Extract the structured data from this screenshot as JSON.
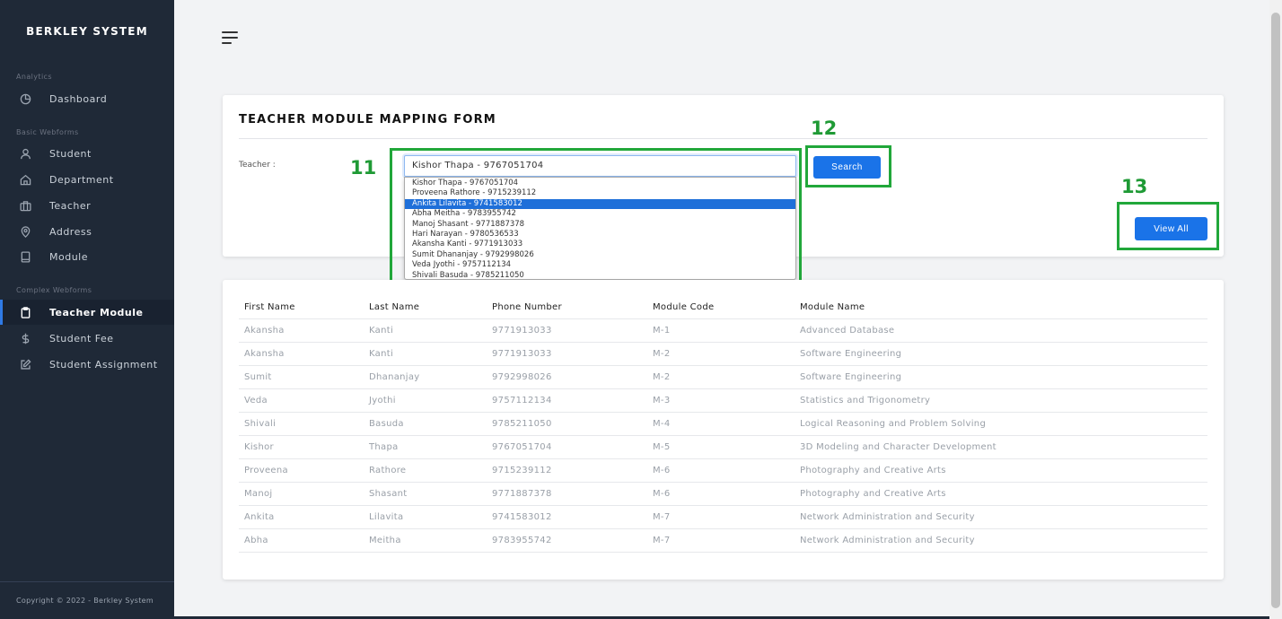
{
  "sidebar": {
    "brand": "BERKLEY SYSTEM",
    "sections": [
      {
        "label": "Analytics"
      },
      {
        "label": "Basic Webforms"
      },
      {
        "label": "Complex Webforms"
      }
    ],
    "items": [
      {
        "label": "Dashboard",
        "icon": "pie-chart-icon"
      },
      {
        "label": "Student",
        "icon": "user-icon"
      },
      {
        "label": "Department",
        "icon": "home-icon"
      },
      {
        "label": "Teacher",
        "icon": "briefcase-icon"
      },
      {
        "label": "Address",
        "icon": "map-pin-icon"
      },
      {
        "label": "Module",
        "icon": "tablet-icon"
      },
      {
        "label": "Teacher Module",
        "icon": "clipboard-icon",
        "active": true
      },
      {
        "label": "Student Fee",
        "icon": "dollar-icon"
      },
      {
        "label": "Student Assignment",
        "icon": "edit-icon"
      }
    ],
    "footer": "Copyright © 2022 - Berkley System"
  },
  "form": {
    "title": "TEACHER MODULE MAPPING FORM",
    "teacher_label": "Teacher :",
    "selected_teacher": "Kishor Thapa - 9767051704",
    "options": [
      "Kishor Thapa - 9767051704",
      "Proveena Rathore - 9715239112",
      "Ankita Lilavita - 9741583012",
      "Abha Meitha - 9783955742",
      "Manoj Shasant - 9771887378",
      "Hari Narayan - 9780536533",
      "Akansha Kanti - 9771913033",
      "Sumit Dhananjay - 9792998026",
      "Veda Jyothi - 9757112134",
      "Shivali Basuda - 9785211050"
    ],
    "highlighted_index": 2,
    "search_label": "Search",
    "view_all_label": "View All"
  },
  "annotations": [
    "11",
    "12",
    "13"
  ],
  "colors": {
    "accent": "#1a73e8",
    "sidebar": "#1f2937",
    "annotation": "#21a73a"
  },
  "table": {
    "headers": [
      "First Name",
      "Last Name",
      "Phone Number",
      "Module Code",
      "Module Name"
    ],
    "rows": [
      [
        "Akansha",
        "Kanti",
        "9771913033",
        "M-1",
        "Advanced Database"
      ],
      [
        "Akansha",
        "Kanti",
        "9771913033",
        "M-2",
        "Software Engineering"
      ],
      [
        "Sumit",
        "Dhananjay",
        "9792998026",
        "M-2",
        "Software Engineering"
      ],
      [
        "Veda",
        "Jyothi",
        "9757112134",
        "M-3",
        "Statistics and Trigonometry"
      ],
      [
        "Shivali",
        "Basuda",
        "9785211050",
        "M-4",
        "Logical Reasoning and Problem Solving"
      ],
      [
        "Kishor",
        "Thapa",
        "9767051704",
        "M-5",
        "3D Modeling and Character Development"
      ],
      [
        "Proveena",
        "Rathore",
        "9715239112",
        "M-6",
        "Photography and Creative Arts"
      ],
      [
        "Manoj",
        "Shasant",
        "9771887378",
        "M-6",
        "Photography and Creative Arts"
      ],
      [
        "Ankita",
        "Lilavita",
        "9741583012",
        "M-7",
        "Network Administration and Security"
      ],
      [
        "Abha",
        "Meitha",
        "9783955742",
        "M-7",
        "Network Administration and Security"
      ]
    ]
  }
}
